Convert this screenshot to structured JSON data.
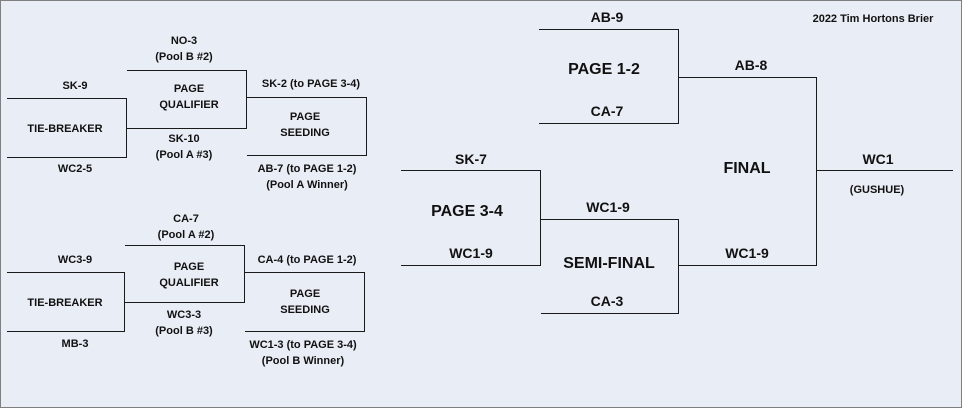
{
  "title": "2022 Tim Hortons Brier",
  "top_bracket": {
    "tb_team1": "SK-9",
    "tb_label": "TIE-BREAKER",
    "tb_team2": "WC2-5",
    "pq_team1_a": "NO-3",
    "pq_team1_b": "(Pool B #2)",
    "pq_label_a": "PAGE",
    "pq_label_b": "QUALIFIER",
    "pq_team2_a": "SK-10",
    "pq_team2_b": "(Pool A #3)",
    "ps_team1": "SK-2 (to PAGE 3-4)",
    "ps_label_a": "PAGE",
    "ps_label_b": "SEEDING",
    "ps_team2_a": "AB-7 (to PAGE 1-2)",
    "ps_team2_b": "(Pool A Winner)"
  },
  "bottom_bracket": {
    "tb_team1": "WC3-9",
    "tb_label": "TIE-BREAKER",
    "tb_team2": "MB-3",
    "pq_team1_a": "CA-7",
    "pq_team1_b": "(Pool A #2)",
    "pq_label_a": "PAGE",
    "pq_label_b": "QUALIFIER",
    "pq_team2_a": "WC3-3",
    "pq_team2_b": "(Pool B #3)",
    "ps_team1": "CA-4 (to PAGE 1-2)",
    "ps_label_a": "PAGE",
    "ps_label_b": "SEEDING",
    "ps_team2_a": "WC1-3 (to PAGE 3-4)",
    "ps_team2_b": "(Pool B Winner)"
  },
  "page12": {
    "team1": "AB-9",
    "label": "PAGE 1-2",
    "team2": "CA-7"
  },
  "page34": {
    "team1": "SK-7",
    "label": "PAGE 3-4",
    "team2": "WC1-9"
  },
  "semi": {
    "team1": "WC1-9",
    "label": "SEMI-FINAL",
    "team2": "CA-3"
  },
  "final": {
    "team1": "AB-8",
    "label": "FINAL",
    "team2": "WC1-9"
  },
  "champion": {
    "team": "WC1",
    "skip": "(GUSHUE)"
  }
}
